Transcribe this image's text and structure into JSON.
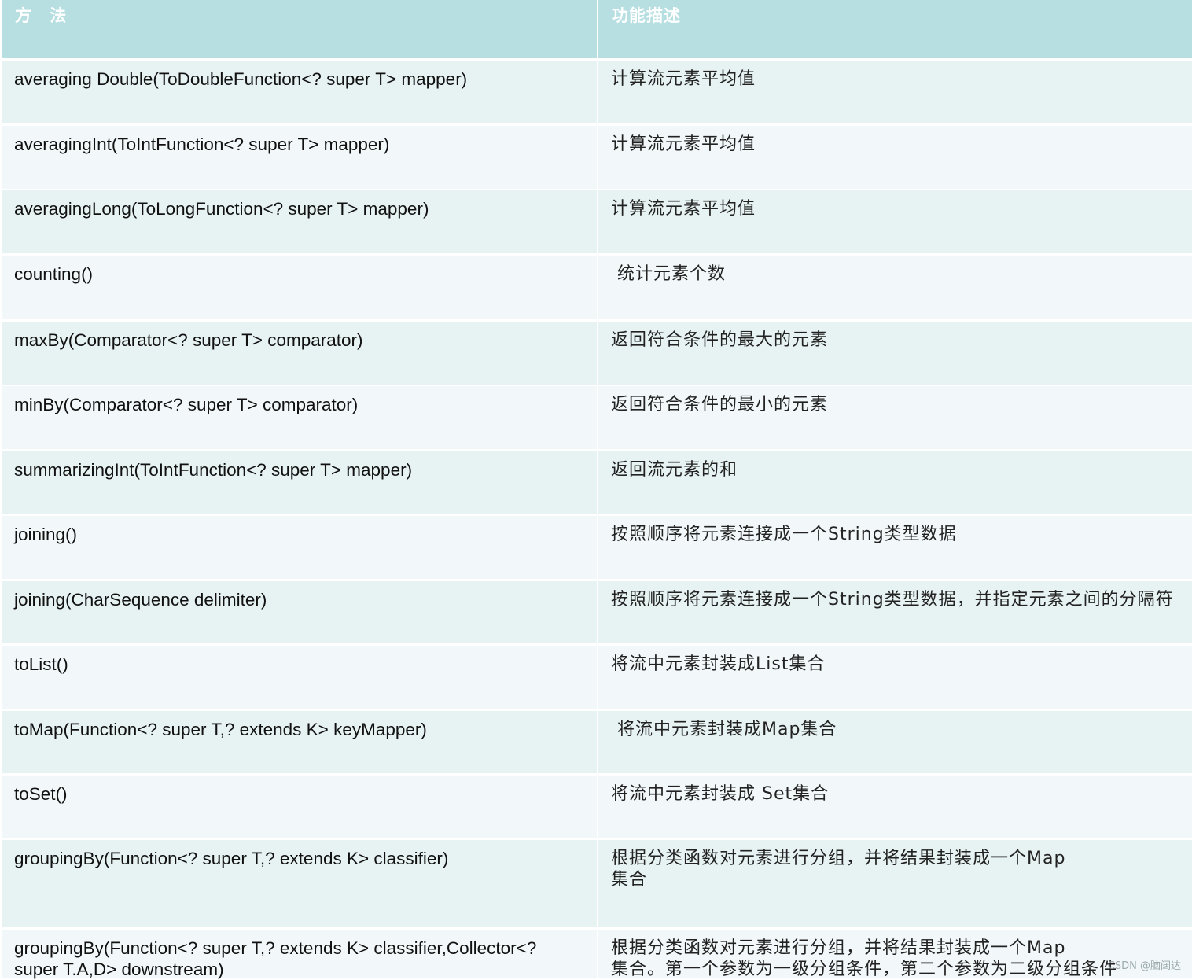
{
  "header": {
    "col1": "方 法",
    "col2": "功能描述"
  },
  "rows": [
    {
      "method": "averaging Double(ToDoubleFunction<? super T> mapper)",
      "desc": "计算流元素平均值"
    },
    {
      "method": "averagingInt(ToIntFunction<? super T> mapper)",
      "desc": "计算流元素平均值"
    },
    {
      "method": "averagingLong(ToLongFunction<? super T> mapper)",
      "desc": "计算流元素平均值"
    },
    {
      "method": "counting()",
      "desc": " 统计元素个数"
    },
    {
      "method": "maxBy(Comparator<? super T> comparator)",
      "desc": "返回符合条件的最大的元素"
    },
    {
      "method": "minBy(Comparator<? super T> comparator)",
      "desc": "返回符合条件的最小的元素"
    },
    {
      "method": "summarizingInt(ToIntFunction<? super T> mapper)",
      "desc": "返回流元素的和"
    },
    {
      "method": "joining()",
      "desc": "按照顺序将元素连接成一个String类型数据"
    },
    {
      "method": "joining(CharSequence delimiter)",
      "desc": "按照顺序将元素连接成一个String类型数据，并指定元素之间的分隔符"
    },
    {
      "method": "toList()",
      "desc": "将流中元素封装成List集合"
    },
    {
      "method": "toMap(Function<? super T,? extends K> keyMapper)",
      "desc": " 将流中元素封装成Map集合"
    },
    {
      "method": "toSet()",
      "desc": "将流中元素封装成 Set集合"
    },
    {
      "method": "groupingBy(Function<? super T,? extends K> classifier)",
      "desc": "根据分类函数对元素进行分组，并将结果封装成一个Map\n集合"
    },
    {
      "method": "groupingBy(Function<? super T,? extends K> classifier,Collector<?\nsuper T.A,D> downstream)",
      "desc": "根据分类函数对元素进行分组，并将结果封装成一个Map\n集合。第一个参数为一级分组条件，第二个参数为二级分组条件"
    }
  ],
  "watermark": "CSDN @脑阔达"
}
